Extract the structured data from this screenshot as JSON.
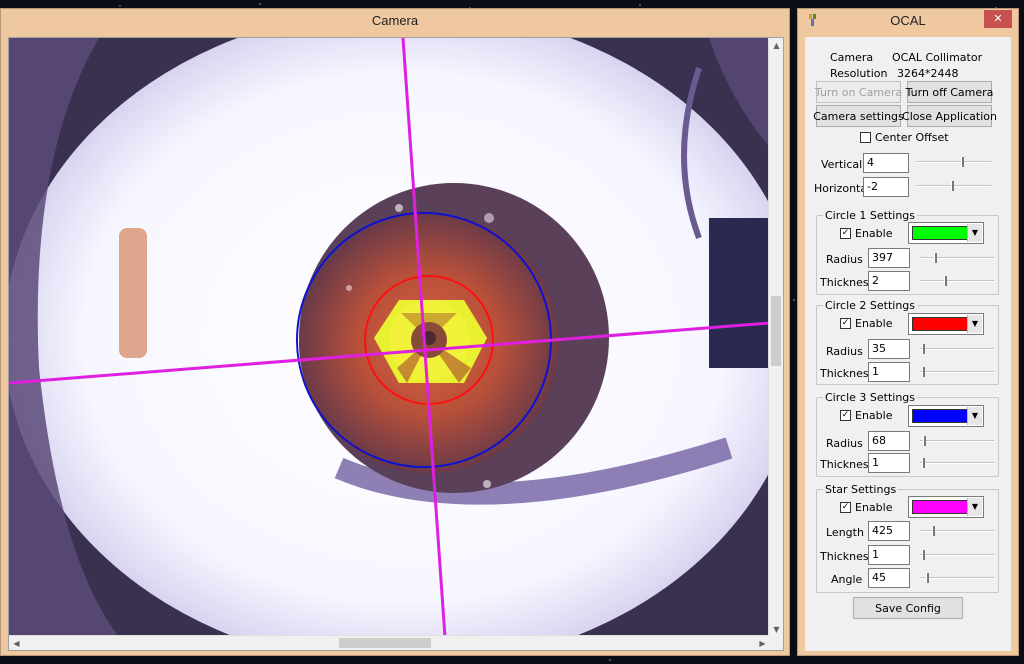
{
  "camera_window": {
    "title": "Camera"
  },
  "ocal_window": {
    "title": "OCAL",
    "close_label": "✕",
    "camera_label": "Camera",
    "camera_value": "OCAL Collimator",
    "resolution_label": "Resolution",
    "resolution_value": "3264*2448",
    "buttons": {
      "turn_on_camera": "Turn on Camera",
      "turn_off_camera": "Turn off Camera",
      "camera_settings": "Camera settings",
      "close_application": "Close Application",
      "save_config": "Save Config"
    },
    "center_offset_label": "Center Offset",
    "center_offset_checked": false,
    "vertical": {
      "label": "Vertical",
      "value": "4"
    },
    "horizontal": {
      "label": "Horizontal",
      "value": "-2"
    },
    "circle1": {
      "title": "Circle 1 Settings",
      "enable_label": "Enable",
      "enabled": true,
      "color": "#00ff00",
      "radius_label": "Radius",
      "radius": "397",
      "thickness_label": "Thickness",
      "thickness": "2"
    },
    "circle2": {
      "title": "Circle 2 Settings",
      "enable_label": "Enable",
      "enabled": true,
      "color": "#ff0000",
      "radius_label": "Radius",
      "radius": "35",
      "thickness_label": "Thickness",
      "thickness": "1"
    },
    "circle3": {
      "title": "Circle 3 Settings",
      "enable_label": "Enable",
      "enabled": true,
      "color": "#0000ff",
      "radius_label": "Radius",
      "radius": "68",
      "thickness_label": "Thickness",
      "thickness": "1"
    },
    "star": {
      "title": "Star Settings",
      "enable_label": "Enable",
      "enabled": true,
      "color": "#ff00ff",
      "length_label": "Length",
      "length": "425",
      "thickness_label": "Thickness",
      "thickness": "1",
      "angle_label": "Angle",
      "angle": "45"
    }
  },
  "icons": {
    "check": "✓",
    "dropdown": "▼",
    "scroll_up": "▲",
    "scroll_down": "▼",
    "scroll_left": "◀",
    "scroll_right": "▶"
  }
}
